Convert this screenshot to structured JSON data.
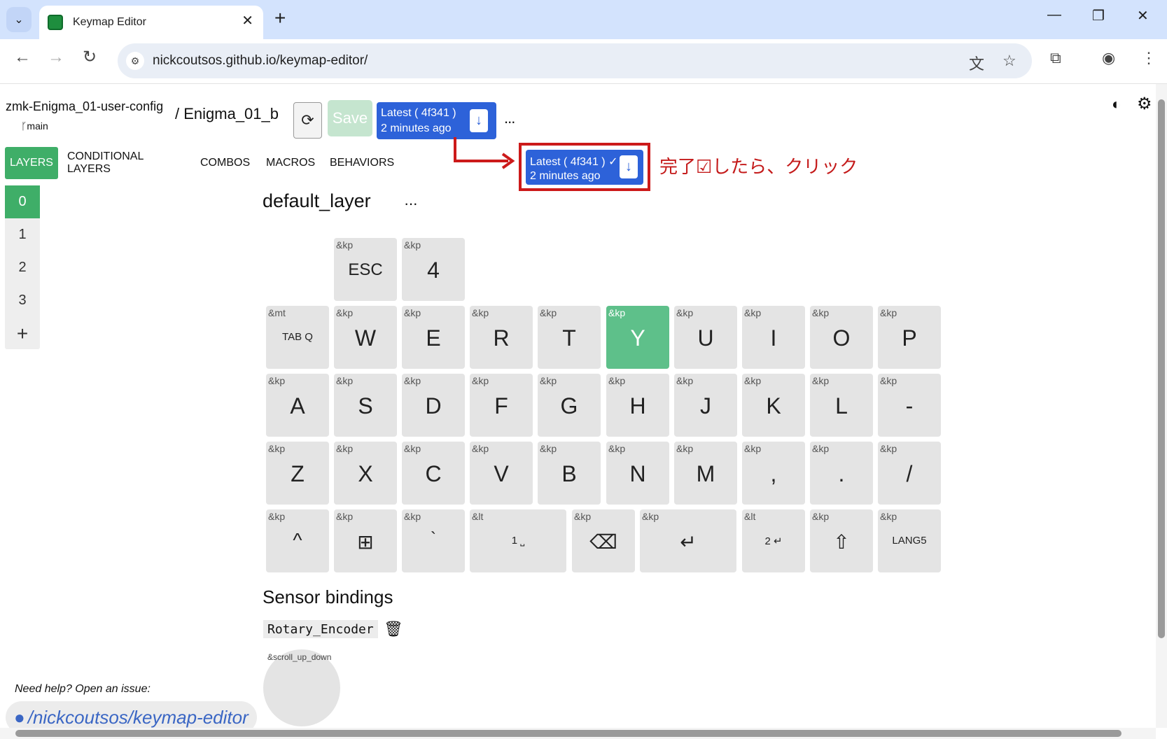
{
  "browser": {
    "tab_title": "Keymap Editor",
    "url": "nickcoutsos.github.io/keymap-editor/"
  },
  "header": {
    "repo": "zmk-Enigma_01-user-config",
    "branch": "main",
    "keyboard": "/ Enigma_01_b",
    "save_label": "Save",
    "build_line1": "Latest ( 4f341 )",
    "build_line2": "2 minutes ago",
    "more": "..."
  },
  "annotation": {
    "build_line1": "Latest ( 4f341 ) ✓",
    "build_line2": "2 minutes ago",
    "note": "完了☑したら、クリック",
    "color": "#cc1a1a"
  },
  "tabs": [
    "LAYERS",
    "CONDITIONAL LAYERS",
    "COMBOS",
    "MACROS",
    "BEHAVIORS"
  ],
  "layers": [
    "0",
    "1",
    "2",
    "3",
    "+"
  ],
  "layer_title": "default_layer",
  "keys": [
    {
      "b": "&kp",
      "l": "ESC",
      "cls": "mid"
    },
    {
      "b": "&kp",
      "l": "4"
    },
    {
      "b": "&mt",
      "l": "TAB Q",
      "cls": "small"
    },
    {
      "b": "&kp",
      "l": "W"
    },
    {
      "b": "&kp",
      "l": "E"
    },
    {
      "b": "&kp",
      "l": "R"
    },
    {
      "b": "&kp",
      "l": "T"
    },
    {
      "b": "&kp",
      "l": "Y"
    },
    {
      "b": "&kp",
      "l": "U"
    },
    {
      "b": "&kp",
      "l": "I"
    },
    {
      "b": "&kp",
      "l": "O"
    },
    {
      "b": "&kp",
      "l": "P"
    },
    {
      "b": "&kp",
      "l": "A"
    },
    {
      "b": "&kp",
      "l": "S"
    },
    {
      "b": "&kp",
      "l": "D"
    },
    {
      "b": "&kp",
      "l": "F"
    },
    {
      "b": "&kp",
      "l": "G"
    },
    {
      "b": "&kp",
      "l": "H"
    },
    {
      "b": "&kp",
      "l": "J"
    },
    {
      "b": "&kp",
      "l": "K"
    },
    {
      "b": "&kp",
      "l": "L"
    },
    {
      "b": "&kp",
      "l": "-"
    },
    {
      "b": "&kp",
      "l": "Z"
    },
    {
      "b": "&kp",
      "l": "X"
    },
    {
      "b": "&kp",
      "l": "C"
    },
    {
      "b": "&kp",
      "l": "V"
    },
    {
      "b": "&kp",
      "l": "B"
    },
    {
      "b": "&kp",
      "l": "N"
    },
    {
      "b": "&kp",
      "l": "M"
    },
    {
      "b": "&kp",
      "l": ","
    },
    {
      "b": "&kp",
      "l": "."
    },
    {
      "b": "&kp",
      "l": "/"
    },
    {
      "b": "&kp",
      "l": "^"
    },
    {
      "b": "&kp",
      "l": "⊞",
      "cls": "icon"
    },
    {
      "b": "&kp",
      "l": "`"
    },
    {
      "b": "&lt",
      "l": "1 ⎵",
      "cls": "small"
    },
    {
      "b": "&kp",
      "l": "⌫",
      "cls": "icon"
    },
    {
      "b": "&kp",
      "l": "↵",
      "cls": "icon"
    },
    {
      "b": "&lt",
      "l": "2 ↵",
      "cls": "small"
    },
    {
      "b": "&kp",
      "l": "⇧",
      "cls": "icon"
    },
    {
      "b": "&kp",
      "l": "LANG5",
      "cls": "small"
    }
  ],
  "sensor": {
    "title": "Sensor bindings",
    "encoder_name": "Rotary_Encoder",
    "binding": "&scroll_up_down"
  },
  "help": {
    "text": "Need help? Open an issue:",
    "link": "/nickcoutsos/keymap-editor"
  },
  "colors": {
    "accent_green": "#3fae68",
    "build_blue": "#2d62d9",
    "annotation_red": "#cc1a1a"
  }
}
